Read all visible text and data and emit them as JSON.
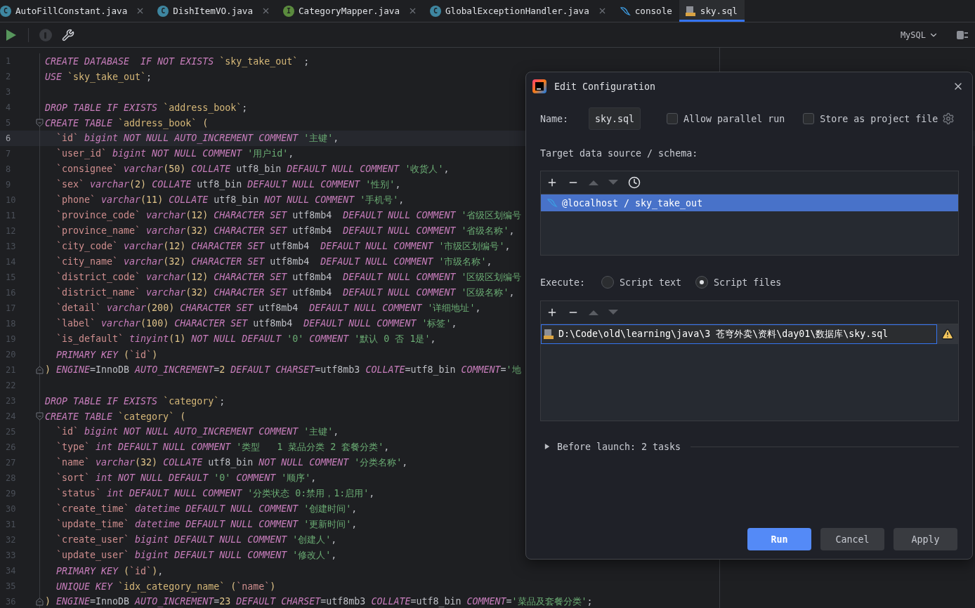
{
  "tabs": [
    {
      "label": "AutoFillConstant.java",
      "kind": "class",
      "badge": "C",
      "selected": false,
      "closable": true
    },
    {
      "label": "DishItemVO.java",
      "kind": "class",
      "badge": "C",
      "selected": false,
      "closable": true
    },
    {
      "label": "CategoryMapper.java",
      "kind": "interface",
      "badge": "I",
      "selected": false,
      "closable": true
    },
    {
      "label": "GlobalExceptionHandler.java",
      "kind": "class",
      "badge": "C",
      "selected": false,
      "closable": true
    },
    {
      "label": "console",
      "kind": "console",
      "selected": false,
      "closable": false
    },
    {
      "label": "sky.sql",
      "kind": "sql",
      "selected": true,
      "closable": false
    }
  ],
  "toolbar": {
    "run_enabled": true,
    "stop_enabled": false,
    "dialect": "MySQL"
  },
  "editor": {
    "lines": [
      {
        "number": "1",
        "tokens": [
          {
            "kind": "kw",
            "text": "CREATE DATABASE  IF NOT EXISTS "
          },
          {
            "kind": "tbl",
            "text": "`sky_take_out`"
          },
          {
            "kind": "plain",
            "text": " ;"
          }
        ]
      },
      {
        "number": "2",
        "tokens": [
          {
            "kind": "kw",
            "text": "USE "
          },
          {
            "kind": "tbl",
            "text": "`sky_take_out`"
          },
          {
            "kind": "plain",
            "text": ";"
          }
        ]
      },
      {
        "number": "3"
      },
      {
        "number": "4",
        "tokens": [
          {
            "kind": "kw",
            "text": "DROP TABLE IF EXISTS "
          },
          {
            "kind": "tbl",
            "text": "`address_book`"
          },
          {
            "kind": "plain",
            "text": ";"
          }
        ]
      },
      {
        "number": "5",
        "fold_start": true,
        "tokens": [
          {
            "kind": "kw",
            "text": "CREATE TABLE "
          },
          {
            "kind": "tbl",
            "text": "`address_book`"
          },
          {
            "kind": "num",
            "text": " ("
          }
        ]
      },
      {
        "number": "6",
        "current": true,
        "tokens": [
          {
            "kind": "col",
            "text": "  `id`"
          },
          {
            "kind": "kw",
            "text": " bigint NOT NULL AUTO_INCREMENT COMMENT "
          },
          {
            "kind": "str",
            "text": "'主键'"
          },
          {
            "kind": "plain",
            "text": ","
          }
        ]
      },
      {
        "number": "7",
        "tokens": [
          {
            "kind": "col",
            "text": "  `user_id`"
          },
          {
            "kind": "kw",
            "text": " bigint NOT NULL COMMENT "
          },
          {
            "kind": "str",
            "text": "'用户id'"
          },
          {
            "kind": "plain",
            "text": ","
          }
        ]
      },
      {
        "number": "8",
        "tokens": [
          {
            "kind": "col",
            "text": "  `consignee`"
          },
          {
            "kind": "kw",
            "text": " varchar"
          },
          {
            "kind": "num",
            "text": "(50)"
          },
          {
            "kind": "kw",
            "text": " COLLATE"
          },
          {
            "kind": "plain",
            "text": " utf8_bin "
          },
          {
            "kind": "kw",
            "text": "DEFAULT NULL COMMENT "
          },
          {
            "kind": "str",
            "text": "'收货人'"
          },
          {
            "kind": "plain",
            "text": ","
          }
        ]
      },
      {
        "number": "9",
        "tokens": [
          {
            "kind": "col",
            "text": "  `sex`"
          },
          {
            "kind": "kw",
            "text": " varchar"
          },
          {
            "kind": "num",
            "text": "(2)"
          },
          {
            "kind": "kw",
            "text": " COLLATE"
          },
          {
            "kind": "plain",
            "text": " utf8_bin "
          },
          {
            "kind": "kw",
            "text": "DEFAULT NULL COMMENT "
          },
          {
            "kind": "str",
            "text": "'性别'"
          },
          {
            "kind": "plain",
            "text": ","
          }
        ]
      },
      {
        "number": "10",
        "tokens": [
          {
            "kind": "col",
            "text": "  `phone`"
          },
          {
            "kind": "kw",
            "text": " varchar"
          },
          {
            "kind": "num",
            "text": "(11)"
          },
          {
            "kind": "kw",
            "text": " COLLATE"
          },
          {
            "kind": "plain",
            "text": " utf8_bin "
          },
          {
            "kind": "kw",
            "text": "NOT NULL COMMENT "
          },
          {
            "kind": "str",
            "text": "'手机号'"
          },
          {
            "kind": "plain",
            "text": ","
          }
        ]
      },
      {
        "number": "11",
        "tokens": [
          {
            "kind": "col",
            "text": "  `province_code`"
          },
          {
            "kind": "kw",
            "text": " varchar"
          },
          {
            "kind": "num",
            "text": "(12)"
          },
          {
            "kind": "kw",
            "text": " CHARACTER SET"
          },
          {
            "kind": "plain",
            "text": " utf8mb4  "
          },
          {
            "kind": "kw",
            "text": "DEFAULT NULL COMMENT "
          },
          {
            "kind": "str",
            "text": "'省级区划编号"
          }
        ]
      },
      {
        "number": "12",
        "tokens": [
          {
            "kind": "col",
            "text": "  `province_name`"
          },
          {
            "kind": "kw",
            "text": " varchar"
          },
          {
            "kind": "num",
            "text": "(32)"
          },
          {
            "kind": "kw",
            "text": " CHARACTER SET"
          },
          {
            "kind": "plain",
            "text": " utf8mb4  "
          },
          {
            "kind": "kw",
            "text": "DEFAULT NULL COMMENT "
          },
          {
            "kind": "str",
            "text": "'省级名称'"
          },
          {
            "kind": "plain",
            "text": ","
          }
        ]
      },
      {
        "number": "13",
        "tokens": [
          {
            "kind": "col",
            "text": "  `city_code`"
          },
          {
            "kind": "kw",
            "text": " varchar"
          },
          {
            "kind": "num",
            "text": "(12)"
          },
          {
            "kind": "kw",
            "text": " CHARACTER SET"
          },
          {
            "kind": "plain",
            "text": " utf8mb4  "
          },
          {
            "kind": "kw",
            "text": "DEFAULT NULL COMMENT "
          },
          {
            "kind": "str",
            "text": "'市级区划编号'"
          },
          {
            "kind": "plain",
            "text": ","
          }
        ]
      },
      {
        "number": "14",
        "tokens": [
          {
            "kind": "col",
            "text": "  `city_name`"
          },
          {
            "kind": "kw",
            "text": " varchar"
          },
          {
            "kind": "num",
            "text": "(32)"
          },
          {
            "kind": "kw",
            "text": " CHARACTER SET"
          },
          {
            "kind": "plain",
            "text": " utf8mb4  "
          },
          {
            "kind": "kw",
            "text": "DEFAULT NULL COMMENT "
          },
          {
            "kind": "str",
            "text": "'市级名称'"
          },
          {
            "kind": "plain",
            "text": ","
          }
        ]
      },
      {
        "number": "15",
        "tokens": [
          {
            "kind": "col",
            "text": "  `district_code`"
          },
          {
            "kind": "kw",
            "text": " varchar"
          },
          {
            "kind": "num",
            "text": "(12)"
          },
          {
            "kind": "kw",
            "text": " CHARACTER SET"
          },
          {
            "kind": "plain",
            "text": " utf8mb4  "
          },
          {
            "kind": "kw",
            "text": "DEFAULT NULL COMMENT "
          },
          {
            "kind": "str",
            "text": "'区级区划编号"
          }
        ]
      },
      {
        "number": "16",
        "tokens": [
          {
            "kind": "col",
            "text": "  `district_name`"
          },
          {
            "kind": "kw",
            "text": " varchar"
          },
          {
            "kind": "num",
            "text": "(32)"
          },
          {
            "kind": "kw",
            "text": " CHARACTER SET"
          },
          {
            "kind": "plain",
            "text": " utf8mb4  "
          },
          {
            "kind": "kw",
            "text": "DEFAULT NULL COMMENT "
          },
          {
            "kind": "str",
            "text": "'区级名称'"
          },
          {
            "kind": "plain",
            "text": ","
          }
        ]
      },
      {
        "number": "17",
        "tokens": [
          {
            "kind": "col",
            "text": "  `detail`"
          },
          {
            "kind": "kw",
            "text": " varchar"
          },
          {
            "kind": "num",
            "text": "(200)"
          },
          {
            "kind": "kw",
            "text": " CHARACTER SET"
          },
          {
            "kind": "plain",
            "text": " utf8mb4  "
          },
          {
            "kind": "kw",
            "text": "DEFAULT NULL COMMENT "
          },
          {
            "kind": "str",
            "text": "'详细地址'"
          },
          {
            "kind": "plain",
            "text": ","
          }
        ]
      },
      {
        "number": "18",
        "tokens": [
          {
            "kind": "col",
            "text": "  `label`"
          },
          {
            "kind": "kw",
            "text": " varchar"
          },
          {
            "kind": "num",
            "text": "(100)"
          },
          {
            "kind": "kw",
            "text": " CHARACTER SET"
          },
          {
            "kind": "plain",
            "text": " utf8mb4  "
          },
          {
            "kind": "kw",
            "text": "DEFAULT NULL COMMENT "
          },
          {
            "kind": "str",
            "text": "'标签'"
          },
          {
            "kind": "plain",
            "text": ","
          }
        ]
      },
      {
        "number": "19",
        "tokens": [
          {
            "kind": "col",
            "text": "  `is_default`"
          },
          {
            "kind": "kw",
            "text": " tinyint"
          },
          {
            "kind": "num",
            "text": "(1)"
          },
          {
            "kind": "kw",
            "text": " NOT NULL DEFAULT "
          },
          {
            "kind": "str",
            "text": "'0'"
          },
          {
            "kind": "kw",
            "text": " COMMENT "
          },
          {
            "kind": "str",
            "text": "'默认 0 否 1是'"
          },
          {
            "kind": "plain",
            "text": ","
          }
        ]
      },
      {
        "number": "20",
        "tokens": [
          {
            "kind": "kw",
            "text": "  PRIMARY KEY "
          },
          {
            "kind": "num",
            "text": "("
          },
          {
            "kind": "col",
            "text": "`id`"
          },
          {
            "kind": "num",
            "text": ")"
          }
        ]
      },
      {
        "number": "21",
        "fold_end": true,
        "tokens": [
          {
            "kind": "num",
            "text": ")"
          },
          {
            "kind": "kw",
            "text": " ENGINE"
          },
          {
            "kind": "plain",
            "text": "=InnoDB "
          },
          {
            "kind": "kw",
            "text": "AUTO_INCREMENT"
          },
          {
            "kind": "plain",
            "text": "="
          },
          {
            "kind": "num",
            "text": "2"
          },
          {
            "kind": "kw",
            "text": " DEFAULT CHARSET"
          },
          {
            "kind": "plain",
            "text": "=utf8mb3 "
          },
          {
            "kind": "kw",
            "text": "COLLATE"
          },
          {
            "kind": "plain",
            "text": "=utf8_bin "
          },
          {
            "kind": "kw",
            "text": "COMMENT"
          },
          {
            "kind": "plain",
            "text": "="
          },
          {
            "kind": "str",
            "text": "'地"
          }
        ]
      },
      {
        "number": "22"
      },
      {
        "number": "23",
        "tokens": [
          {
            "kind": "kw",
            "text": "DROP TABLE IF EXISTS "
          },
          {
            "kind": "tbl",
            "text": "`category`"
          },
          {
            "kind": "plain",
            "text": ";"
          }
        ]
      },
      {
        "number": "24",
        "fold_start": true,
        "tokens": [
          {
            "kind": "kw",
            "text": "CREATE TABLE "
          },
          {
            "kind": "tbl",
            "text": "`category`"
          },
          {
            "kind": "num",
            "text": " ("
          }
        ]
      },
      {
        "number": "25",
        "tokens": [
          {
            "kind": "col",
            "text": "  `id`"
          },
          {
            "kind": "kw",
            "text": " bigint NOT NULL AUTO_INCREMENT COMMENT "
          },
          {
            "kind": "str",
            "text": "'主键'"
          },
          {
            "kind": "plain",
            "text": ","
          }
        ]
      },
      {
        "number": "26",
        "tokens": [
          {
            "kind": "col",
            "text": "  `type`"
          },
          {
            "kind": "kw",
            "text": " int DEFAULT NULL COMMENT "
          },
          {
            "kind": "str",
            "text": "'类型   1 菜品分类 2 套餐分类'"
          },
          {
            "kind": "plain",
            "text": ","
          }
        ]
      },
      {
        "number": "27",
        "tokens": [
          {
            "kind": "col",
            "text": "  `name`"
          },
          {
            "kind": "kw",
            "text": " varchar"
          },
          {
            "kind": "num",
            "text": "(32)"
          },
          {
            "kind": "kw",
            "text": " COLLATE"
          },
          {
            "kind": "plain",
            "text": " utf8_bin "
          },
          {
            "kind": "kw",
            "text": "NOT NULL COMMENT "
          },
          {
            "kind": "str",
            "text": "'分类名称'"
          },
          {
            "kind": "plain",
            "text": ","
          }
        ]
      },
      {
        "number": "28",
        "tokens": [
          {
            "kind": "col",
            "text": "  `sort`"
          },
          {
            "kind": "kw",
            "text": " int NOT NULL DEFAULT "
          },
          {
            "kind": "str",
            "text": "'0'"
          },
          {
            "kind": "kw",
            "text": " COMMENT "
          },
          {
            "kind": "str",
            "text": "'顺序'"
          },
          {
            "kind": "plain",
            "text": ","
          }
        ]
      },
      {
        "number": "29",
        "tokens": [
          {
            "kind": "col",
            "text": "  `status`"
          },
          {
            "kind": "kw",
            "text": " int DEFAULT NULL COMMENT "
          },
          {
            "kind": "str",
            "text": "'分类状态 0:禁用，1:启用'"
          },
          {
            "kind": "plain",
            "text": ","
          }
        ]
      },
      {
        "number": "30",
        "tokens": [
          {
            "kind": "col",
            "text": "  `create_time`"
          },
          {
            "kind": "kw",
            "text": " datetime DEFAULT NULL COMMENT "
          },
          {
            "kind": "str",
            "text": "'创建时间'"
          },
          {
            "kind": "plain",
            "text": ","
          }
        ]
      },
      {
        "number": "31",
        "tokens": [
          {
            "kind": "col",
            "text": "  `update_time`"
          },
          {
            "kind": "kw",
            "text": " datetime DEFAULT NULL COMMENT "
          },
          {
            "kind": "str",
            "text": "'更新时间'"
          },
          {
            "kind": "plain",
            "text": ","
          }
        ]
      },
      {
        "number": "32",
        "tokens": [
          {
            "kind": "col",
            "text": "  `create_user`"
          },
          {
            "kind": "kw",
            "text": " bigint DEFAULT NULL COMMENT "
          },
          {
            "kind": "str",
            "text": "'创建人'"
          },
          {
            "kind": "plain",
            "text": ","
          }
        ]
      },
      {
        "number": "33",
        "tokens": [
          {
            "kind": "col",
            "text": "  `update_user`"
          },
          {
            "kind": "kw",
            "text": " bigint DEFAULT NULL COMMENT "
          },
          {
            "kind": "str",
            "text": "'修改人'"
          },
          {
            "kind": "plain",
            "text": ","
          }
        ]
      },
      {
        "number": "34",
        "tokens": [
          {
            "kind": "kw",
            "text": "  PRIMARY KEY "
          },
          {
            "kind": "num",
            "text": "("
          },
          {
            "kind": "col",
            "text": "`id`"
          },
          {
            "kind": "num",
            "text": ")"
          },
          {
            "kind": "plain",
            "text": ","
          }
        ]
      },
      {
        "number": "35",
        "tokens": [
          {
            "kind": "kw",
            "text": "  UNIQUE KEY "
          },
          {
            "kind": "tbl",
            "text": "`idx_category_name`"
          },
          {
            "kind": "num",
            "text": " ("
          },
          {
            "kind": "col",
            "text": "`name`"
          },
          {
            "kind": "num",
            "text": ")"
          }
        ]
      },
      {
        "number": "36",
        "fold_end": true,
        "tokens": [
          {
            "kind": "num",
            "text": ")"
          },
          {
            "kind": "kw",
            "text": " ENGINE"
          },
          {
            "kind": "plain",
            "text": "=InnoDB "
          },
          {
            "kind": "kw",
            "text": "AUTO_INCREMENT"
          },
          {
            "kind": "plain",
            "text": "="
          },
          {
            "kind": "num",
            "text": "23"
          },
          {
            "kind": "kw",
            "text": " DEFAULT CHARSET"
          },
          {
            "kind": "plain",
            "text": "=utf8mb3 "
          },
          {
            "kind": "kw",
            "text": "COLLATE"
          },
          {
            "kind": "plain",
            "text": "=utf8_bin "
          },
          {
            "kind": "kw",
            "text": "COMMENT"
          },
          {
            "kind": "plain",
            "text": "="
          },
          {
            "kind": "str",
            "text": "'菜品及套餐分类'"
          },
          {
            "kind": "plain",
            "text": ";"
          }
        ]
      }
    ]
  },
  "dialog": {
    "title": "Edit Configuration",
    "name_label": "Name:",
    "name_value": "sky.sql",
    "options": [
      {
        "label": "Allow parallel run",
        "checked": false
      },
      {
        "label": "Store as project file",
        "checked": false
      }
    ],
    "target_label": "Target data source / schema:",
    "target_toolbar": [
      {
        "kind": "add",
        "disabled": false
      },
      {
        "kind": "remove",
        "disabled": false
      },
      {
        "kind": "up",
        "disabled": true
      },
      {
        "kind": "down",
        "disabled": true
      },
      {
        "kind": "history",
        "disabled": false
      }
    ],
    "targets": [
      {
        "label": "@localhost / sky_take_out",
        "selected": true
      }
    ],
    "execute_label": "Execute:",
    "execute_options": [
      {
        "label": "Script text",
        "selected": false
      },
      {
        "label": "Script files",
        "selected": true
      }
    ],
    "files_toolbar": [
      {
        "kind": "add",
        "disabled": false
      },
      {
        "kind": "remove",
        "disabled": false
      },
      {
        "kind": "up",
        "disabled": true
      },
      {
        "kind": "down",
        "disabled": true
      }
    ],
    "files": [
      {
        "path": "D:\\Code\\old\\learning\\java\\3 苍穹外卖\\资料\\day01\\数据库\\sky.sql",
        "warning": true
      }
    ],
    "before_launch": {
      "label": "Before launch: 2 tasks",
      "expanded": false
    },
    "buttons": [
      {
        "label": "Run",
        "kind": "primary"
      },
      {
        "label": "Cancel",
        "kind": "secondary"
      },
      {
        "label": "Apply",
        "kind": "secondary"
      }
    ]
  }
}
